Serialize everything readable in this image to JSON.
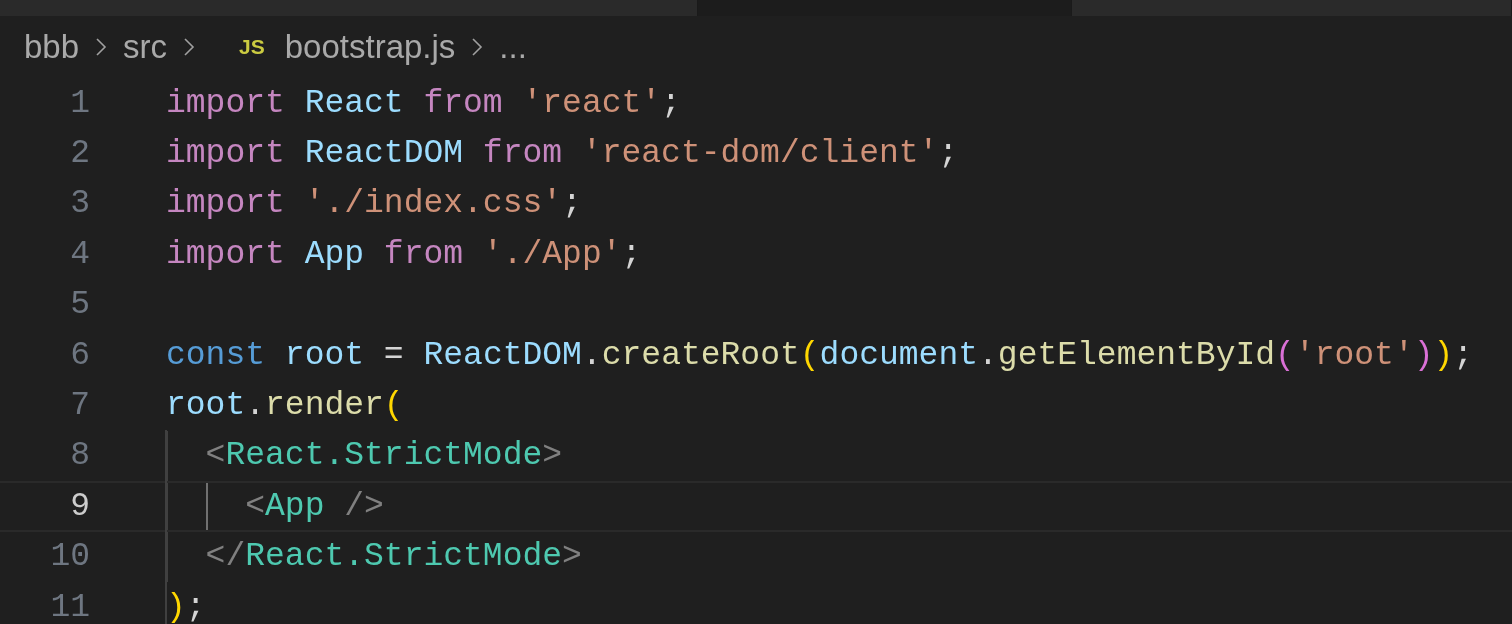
{
  "tabs": [
    {
      "selected": false
    },
    {
      "selected": true
    },
    {
      "selected": false
    }
  ],
  "breadcrumb": {
    "items": [
      {
        "label": "bbb"
      },
      {
        "label": "src"
      },
      {
        "label": "bootstrap.js",
        "badge": "JS"
      },
      {
        "label": "..."
      }
    ]
  },
  "editor": {
    "lines": [
      {
        "number": "1",
        "current": false,
        "tokens": [
          {
            "text": "import ",
            "kind": "keyword"
          },
          {
            "text": "React ",
            "kind": "variable"
          },
          {
            "text": "from ",
            "kind": "keyword"
          },
          {
            "text": "'react'",
            "kind": "string"
          },
          {
            "text": ";",
            "kind": "plain"
          }
        ]
      },
      {
        "number": "2",
        "current": false,
        "tokens": [
          {
            "text": "import ",
            "kind": "keyword"
          },
          {
            "text": "ReactDOM ",
            "kind": "variable"
          },
          {
            "text": "from ",
            "kind": "keyword"
          },
          {
            "text": "'react-dom/client'",
            "kind": "string"
          },
          {
            "text": ";",
            "kind": "plain"
          }
        ]
      },
      {
        "number": "3",
        "current": false,
        "tokens": [
          {
            "text": "import ",
            "kind": "keyword"
          },
          {
            "text": "'./index.css'",
            "kind": "string"
          },
          {
            "text": ";",
            "kind": "plain"
          }
        ]
      },
      {
        "number": "4",
        "current": false,
        "tokens": [
          {
            "text": "import ",
            "kind": "keyword"
          },
          {
            "text": "App ",
            "kind": "variable"
          },
          {
            "text": "from ",
            "kind": "keyword"
          },
          {
            "text": "'./App'",
            "kind": "string"
          },
          {
            "text": ";",
            "kind": "plain"
          }
        ]
      },
      {
        "number": "5",
        "current": false
      },
      {
        "number": "6",
        "current": false,
        "tokens": [
          {
            "text": "const ",
            "kind": "storage"
          },
          {
            "text": "root",
            "kind": "variable"
          },
          {
            "text": " = ",
            "kind": "plain"
          },
          {
            "text": "ReactDOM",
            "kind": "variable"
          },
          {
            "text": ".",
            "kind": "plain"
          },
          {
            "text": "createRoot",
            "kind": "function"
          },
          {
            "text": "(",
            "kind": "bracket1"
          },
          {
            "text": "document",
            "kind": "variable"
          },
          {
            "text": ".",
            "kind": "plain"
          },
          {
            "text": "getElementById",
            "kind": "function"
          },
          {
            "text": "(",
            "kind": "bracket2"
          },
          {
            "text": "'root'",
            "kind": "string"
          },
          {
            "text": ")",
            "kind": "bracket2"
          },
          {
            "text": ")",
            "kind": "bracket1"
          },
          {
            "text": ";",
            "kind": "plain"
          }
        ]
      },
      {
        "number": "7",
        "current": false,
        "tokens": [
          {
            "text": "root",
            "kind": "variable"
          },
          {
            "text": ".",
            "kind": "plain"
          },
          {
            "text": "render",
            "kind": "function"
          },
          {
            "text": "(",
            "kind": "bracket1"
          }
        ]
      },
      {
        "number": "8",
        "current": false,
        "tokens": [
          {
            "text": "  <",
            "kind": "punct"
          },
          {
            "text": "React.StrictMode",
            "kind": "tag"
          },
          {
            "text": ">",
            "kind": "punct"
          }
        ]
      },
      {
        "number": "9",
        "current": true,
        "tokens": [
          {
            "text": "    <",
            "kind": "punct"
          },
          {
            "text": "App",
            "kind": "tag"
          },
          {
            "text": " />",
            "kind": "punct"
          }
        ]
      },
      {
        "number": "10",
        "current": false,
        "tokens": [
          {
            "text": "  </",
            "kind": "punct"
          },
          {
            "text": "React.StrictMode",
            "kind": "tag"
          },
          {
            "text": ">",
            "kind": "punct"
          }
        ]
      },
      {
        "number": "11",
        "current": false,
        "tokens": [
          {
            "text": ")",
            "kind": "bracket1"
          },
          {
            "text": ";",
            "kind": "plain"
          }
        ]
      }
    ]
  }
}
